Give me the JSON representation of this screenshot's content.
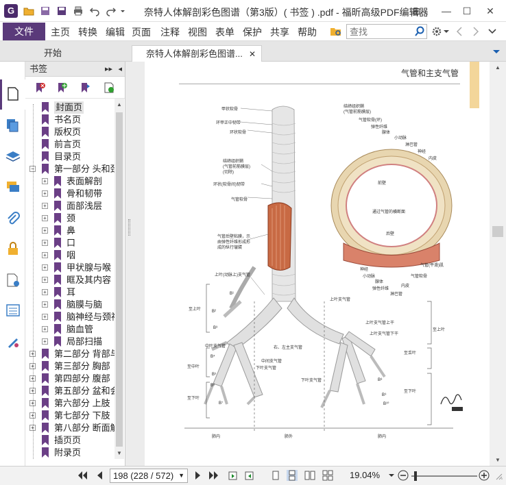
{
  "window": {
    "title": "奈特人体解剖彩色图谱（第3版）( 书签 ) .pdf - 福昕高级PDF编辑器",
    "app_icon_letter": "G"
  },
  "menu": {
    "file": "文件",
    "items": [
      "主页",
      "转换",
      "编辑",
      "页面",
      "注释",
      "视图",
      "表单",
      "保护",
      "共享",
      "帮助"
    ],
    "search_placeholder": "查找"
  },
  "tabs": [
    {
      "label": "开始",
      "active": false
    },
    {
      "label": "奈特人体解剖彩色图谱...",
      "active": true
    }
  ],
  "bookmarks": {
    "header": "书签",
    "items": [
      {
        "label": "封面页",
        "level": 0,
        "expander": "",
        "selected": true
      },
      {
        "label": "书名页",
        "level": 0,
        "expander": ""
      },
      {
        "label": "版权页",
        "level": 0,
        "expander": ""
      },
      {
        "label": "前言页",
        "level": 0,
        "expander": ""
      },
      {
        "label": "目录页",
        "level": 0,
        "expander": ""
      },
      {
        "label": "第一部分 头和颈",
        "level": 0,
        "expander": "−"
      },
      {
        "label": "表面解剖",
        "level": 1,
        "expander": "+"
      },
      {
        "label": "骨和韧带",
        "level": 1,
        "expander": "+"
      },
      {
        "label": "面部浅层",
        "level": 1,
        "expander": "+"
      },
      {
        "label": "颈",
        "level": 1,
        "expander": "+"
      },
      {
        "label": "鼻",
        "level": 1,
        "expander": "+"
      },
      {
        "label": "口",
        "level": 1,
        "expander": "+"
      },
      {
        "label": "咽",
        "level": 1,
        "expander": "+"
      },
      {
        "label": "甲状腺与喉",
        "level": 1,
        "expander": "+"
      },
      {
        "label": "眶及其内容",
        "level": 1,
        "expander": "+"
      },
      {
        "label": "耳",
        "level": 1,
        "expander": "+"
      },
      {
        "label": "脑膜与脑",
        "level": 1,
        "expander": "+"
      },
      {
        "label": "脑神经与颈神",
        "level": 1,
        "expander": "+"
      },
      {
        "label": "脑血管",
        "level": 1,
        "expander": "+"
      },
      {
        "label": "局部扫描",
        "level": 1,
        "expander": "+"
      },
      {
        "label": "第二部分 背部与",
        "level": 0,
        "expander": "+"
      },
      {
        "label": "第三部分 胸部",
        "level": 0,
        "expander": "+"
      },
      {
        "label": "第四部分 腹部",
        "level": 0,
        "expander": "+"
      },
      {
        "label": "第五部分 盆和会",
        "level": 0,
        "expander": "+"
      },
      {
        "label": "第六部分 上肢",
        "level": 0,
        "expander": "+"
      },
      {
        "label": "第七部分 下肢",
        "level": 0,
        "expander": "+"
      },
      {
        "label": "第八部分 断面解",
        "level": 0,
        "expander": "+"
      },
      {
        "label": "插页页",
        "level": 0,
        "expander": ""
      },
      {
        "label": "附录页",
        "level": 0,
        "expander": ""
      }
    ]
  },
  "document": {
    "page_heading": "气管和主支气管",
    "labels": {
      "l1": "甲状软骨",
      "l2": "环甲正中韧带",
      "l3": "环状软骨",
      "l4": "结缔组织鞘",
      "l5": "(气管前筋膜层)",
      "l6": "(切除)",
      "l7": "环状(软骨间)韧带",
      "l8": "气管软骨",
      "l9": "气管后壁粘膜，示",
      "l10": "由弹性纤维形成形",
      "l11": "成的纵行皱襞",
      "l12": "上叶(动脉上)支气管",
      "l13": "右、左主支气管",
      "l14": "中叶支气管",
      "l15": "中间支气管",
      "l16": "下叶支气管",
      "l17": "上叶支气管",
      "l18": "下叶支气管",
      "l19": "至上叶",
      "l20": "至中叶",
      "l21": "至下叶",
      "l22": "至上叶",
      "l23": "至舌叶",
      "l24": "至下叶",
      "l25": "肺内",
      "l26": "肺外",
      "l27": "肺内",
      "l28": "上叶支气管上干",
      "l29": "上叶支气管下干",
      "c1": "结缔组织鞘",
      "c2": "(气管前筋膜层)",
      "c3": "气管软骨(环)",
      "c4": "弹性纤维",
      "c5": "腺体",
      "c6": "小动脉",
      "c7": "淋巴管",
      "c8": "神经",
      "c9": "内皮",
      "c10": "前壁",
      "c11": "通过气管的横断面",
      "c12": "后壁",
      "c13": "气管(平滑)肌",
      "c14": "神经",
      "c15": "小动脉",
      "c16": "腺体",
      "c17": "弹性纤维",
      "c18": "淋巴管",
      "c19": "内皮",
      "c20": "气管软骨"
    },
    "segment_marks": [
      "B¹",
      "B²",
      "B³",
      "B⁴",
      "B⁵",
      "B⁶",
      "B⁷",
      "B⁸",
      "B⁹",
      "B¹⁰"
    ]
  },
  "statusbar": {
    "page_field": "198 (228 / 572)",
    "zoom": "19.04%"
  },
  "colors": {
    "accent": "#5a3a7a",
    "bookmark_flag": "#6b3f86",
    "muscle": "#c86a44",
    "trachea": "#d9d9d9"
  }
}
